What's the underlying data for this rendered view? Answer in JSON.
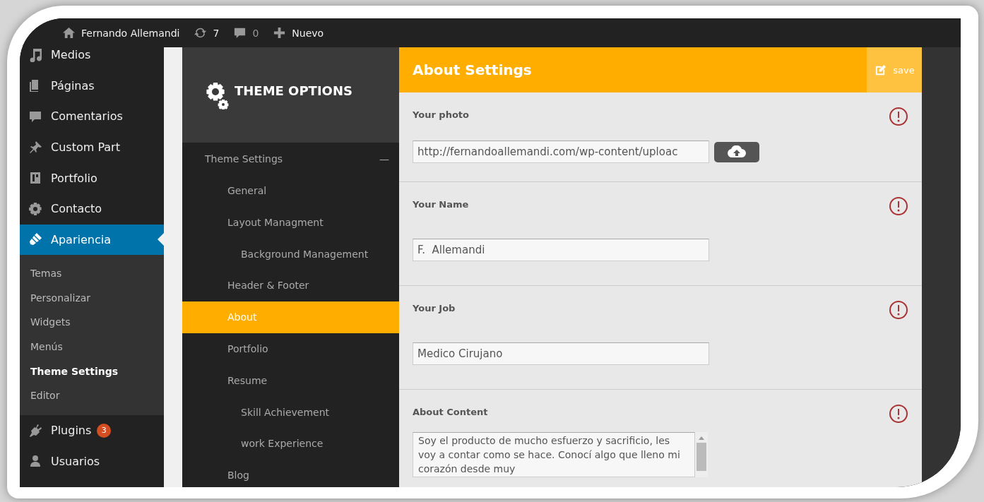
{
  "admin_bar": {
    "site_name": "Fernando Allemandi",
    "updates": "7",
    "comments": "0",
    "new": "Nuevo"
  },
  "sidebar": {
    "items": [
      {
        "label": "Medios",
        "kind": "media",
        "selected": false
      },
      {
        "label": "Páginas",
        "kind": "pages",
        "selected": false
      },
      {
        "label": "Comentarios",
        "kind": "comment",
        "selected": false
      },
      {
        "label": "Custom Part",
        "kind": "pin",
        "selected": false
      },
      {
        "label": "Portfolio",
        "kind": "portfolio",
        "selected": false
      },
      {
        "label": "Contacto",
        "kind": "gear",
        "selected": false
      },
      {
        "label": "Apariencia",
        "kind": "brush",
        "selected": true,
        "submenu": [
          {
            "label": "Temas",
            "selected": false
          },
          {
            "label": "Personalizar",
            "selected": false
          },
          {
            "label": "Widgets",
            "selected": false
          },
          {
            "label": "Menús",
            "selected": false
          },
          {
            "label": "Theme Settings",
            "selected": true
          },
          {
            "label": "Editor",
            "selected": false
          }
        ]
      },
      {
        "label": "Plugins",
        "kind": "plug",
        "selected": false,
        "badge": "3"
      },
      {
        "label": "Usuarios",
        "kind": "user",
        "selected": false
      }
    ]
  },
  "theme_panel": {
    "title": "THEME OPTIONS",
    "section": {
      "label": "Theme Settings",
      "toggle": "—",
      "expanded": true,
      "children": [
        {
          "label": "General",
          "selected": false
        },
        {
          "label": "Layout Managment",
          "selected": false,
          "children": [
            {
              "label": "Background Management",
              "selected": false
            }
          ]
        },
        {
          "label": "Header & Footer",
          "selected": false
        },
        {
          "label": "About",
          "selected": true
        },
        {
          "label": "Portfolio",
          "selected": false
        },
        {
          "label": "Resume",
          "selected": false,
          "children": [
            {
              "label": "Skill Achievement",
              "selected": false
            },
            {
              "label": "work Experience",
              "selected": false
            }
          ]
        },
        {
          "label": "Blog",
          "selected": false
        }
      ]
    }
  },
  "settings": {
    "title": "About Settings",
    "save": "save",
    "fields": [
      {
        "kind": "upload",
        "label": "Your photo",
        "value": "http://fernandoallemandi.com/wp-content/uploac"
      },
      {
        "kind": "text",
        "label": "Your Name",
        "value": "F.  Allemandi"
      },
      {
        "kind": "text",
        "label": "Your Job",
        "value": "Medico Cirujano"
      },
      {
        "kind": "textarea",
        "label": "About Content",
        "value": "Soy el producto de mucho esfuerzo y sacrificio, les voy a contar como se hace. Conocí algo que lleno mi corazón desde muy"
      }
    ]
  }
}
